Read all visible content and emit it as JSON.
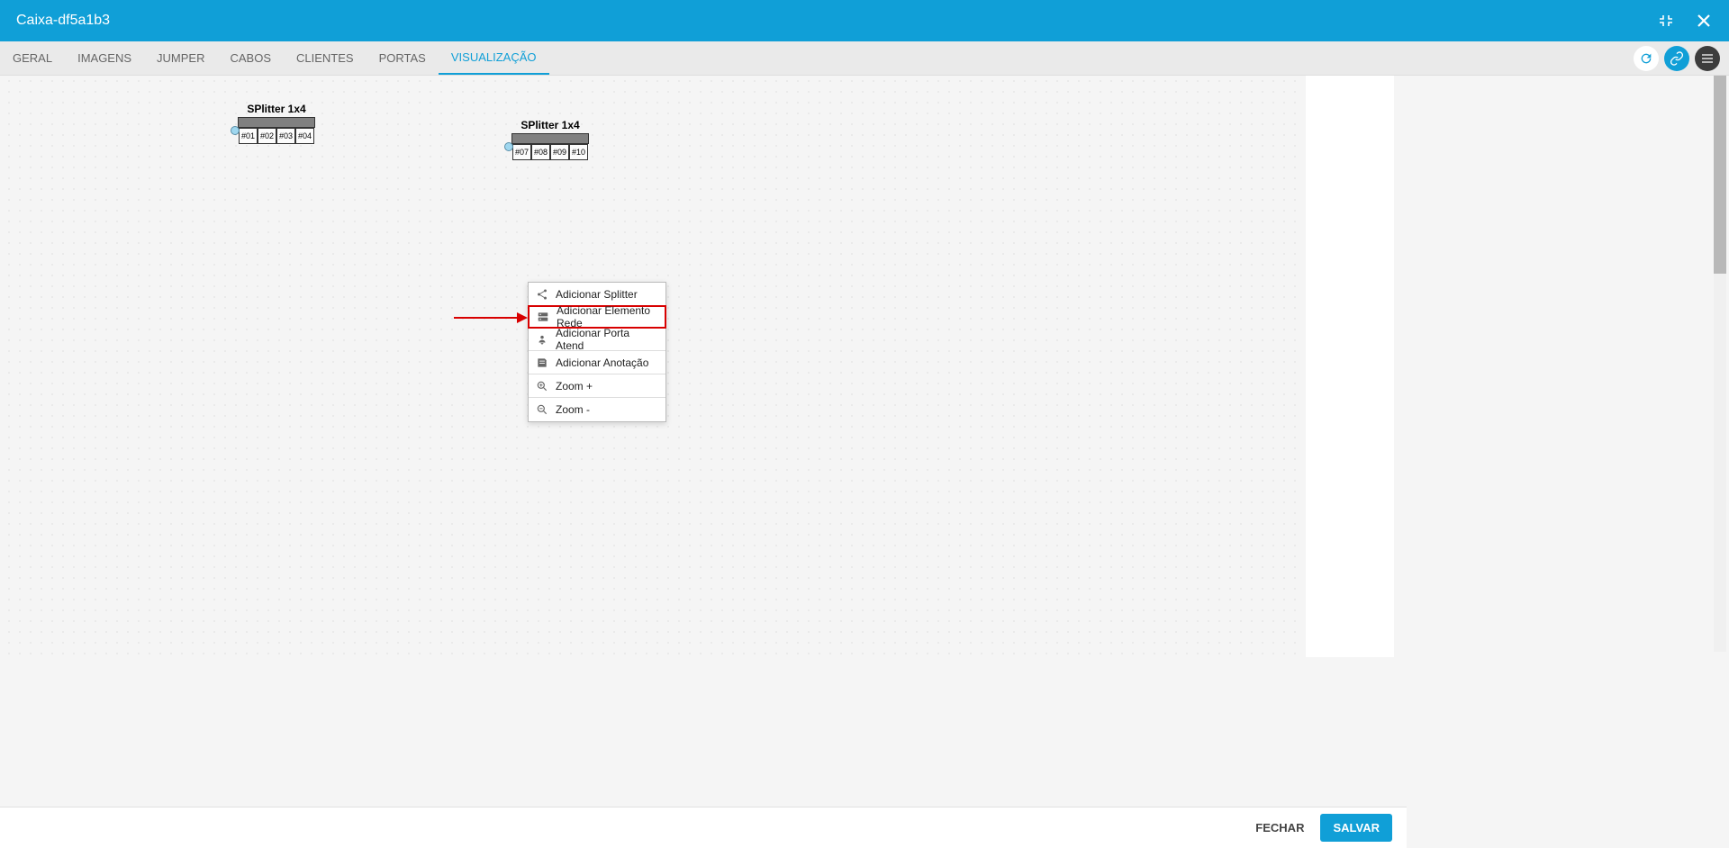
{
  "titlebar": {
    "title": "Caixa-df5a1b3"
  },
  "tabs": {
    "geral": "GERAL",
    "imagens": "IMAGENS",
    "jumper": "JUMPER",
    "cabos": "CABOS",
    "clientes": "CLIENTES",
    "portas": "PORTAS",
    "visualizacao": "VISUALIZAÇÃO"
  },
  "splitters": [
    {
      "label": "SPlitter 1x4",
      "ports": [
        "#01",
        "#02",
        "#03",
        "#04"
      ]
    },
    {
      "label": "SPlitter 1x4",
      "ports": [
        "#07",
        "#08",
        "#09",
        "#10"
      ]
    }
  ],
  "contextMenu": {
    "addSplitter": "Adicionar Splitter",
    "addElementoRede": "Adicionar Elemento Rede",
    "addPortaAtend": "Adicionar Porta Atend",
    "addAnotacao": "Adicionar Anotação",
    "zoomIn": "Zoom +",
    "zoomOut": "Zoom -"
  },
  "footer": {
    "fechar": "FECHAR",
    "salvar": "SALVAR"
  }
}
